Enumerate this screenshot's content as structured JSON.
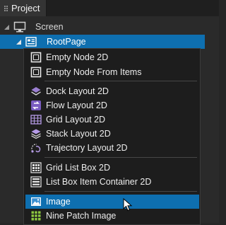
{
  "tab": {
    "title": "Project"
  },
  "tree": {
    "screen_label": "Screen",
    "root_label": "RootPage"
  },
  "context_menu": {
    "groups": [
      {
        "items": [
          {
            "label": "Empty Node 2D",
            "icon": "empty-node-icon"
          },
          {
            "label": "Empty Node From Items",
            "icon": "empty-node-icon"
          }
        ]
      },
      {
        "items": [
          {
            "label": "Dock Layout 2D",
            "icon": "dock-layout-icon"
          },
          {
            "label": "Flow Layout 2D",
            "icon": "flow-layout-icon"
          },
          {
            "label": "Grid Layout 2D",
            "icon": "grid-layout-icon"
          },
          {
            "label": "Stack Layout 2D",
            "icon": "stack-layout-icon"
          },
          {
            "label": "Trajectory Layout 2D",
            "icon": "trajectory-layout-icon"
          }
        ]
      },
      {
        "items": [
          {
            "label": "Grid List Box 2D",
            "icon": "grid-list-box-icon"
          },
          {
            "label": "List Box Item Container 2D",
            "icon": "list-box-item-container-icon"
          }
        ]
      },
      {
        "items": [
          {
            "label": "Image",
            "icon": "image-icon",
            "selected": true
          },
          {
            "label": "Nine Patch Image",
            "icon": "nine-patch-image-icon"
          }
        ]
      }
    ]
  },
  "colors": {
    "selection": "#0e6fb0",
    "menu_background": "#1d1d1d",
    "panel_background": "#2a2a2a"
  }
}
